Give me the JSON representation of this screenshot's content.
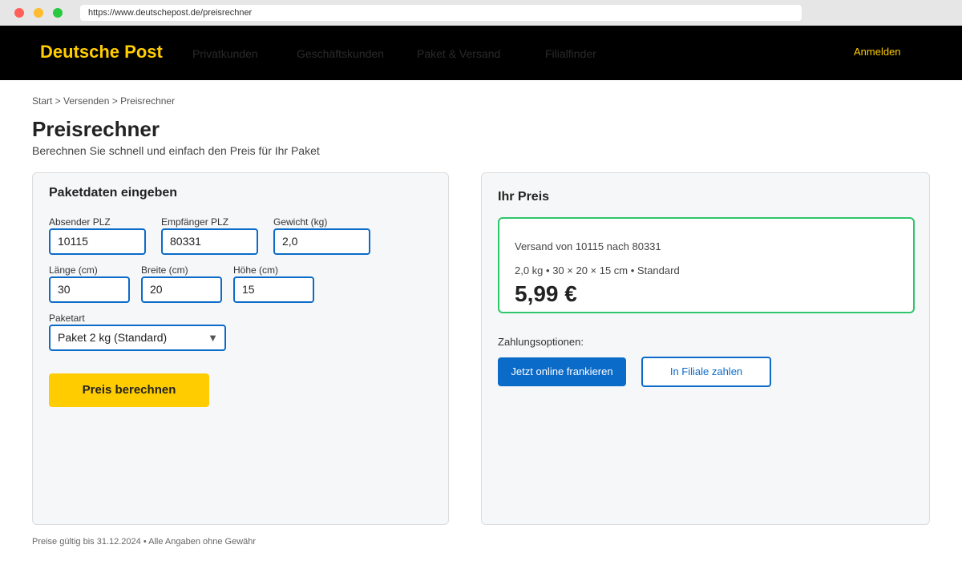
{
  "browser": {
    "url": "https://www.deutschepost.de/preisrechner"
  },
  "header": {
    "brand": "Deutsche Post",
    "nav": [
      "Privatkunden",
      "Geschäftskunden",
      "Paket & Versand",
      "Filialfinder"
    ],
    "login": "Anmelden"
  },
  "breadcrumb": "Start > Versenden > Preisrechner",
  "page": {
    "title": "Preisrechner",
    "subtitle": "Berechnen Sie schnell und einfach den Preis für Ihr Paket"
  },
  "form": {
    "title": "Paketdaten eingeben",
    "sender_zip_label": "Absender PLZ",
    "sender_zip_value": "10115",
    "recipient_zip_label": "Empfänger PLZ",
    "recipient_zip_value": "80331",
    "weight_label": "Gewicht (kg)",
    "weight_value": "2,0",
    "length_label": "Länge (cm)",
    "length_value": "30",
    "width_label": "Breite (cm)",
    "width_value": "20",
    "height_label": "Höhe (cm)",
    "height_value": "15",
    "type_label": "Paketart",
    "type_value": "Paket 2 kg (Standard)",
    "submit": "Preis berechnen"
  },
  "result": {
    "title": "Ihr Preis",
    "route": "Versand von 10115 nach 80331",
    "details": "2,0 kg • 30 × 20 × 15 cm • Standard",
    "price": "5,99 €",
    "payment_label": "Zahlungsoptionen:",
    "pay_online": "Jetzt online frankieren",
    "pay_branch": "In Filiale zahlen"
  },
  "footnote": "Preise gültig bis 31.12.2024 • Alle Angaben ohne Gewähr",
  "colors": {
    "brand_yellow": "#ffcc00",
    "header_bg": "#000000",
    "accent_blue": "#0b6bc9",
    "success_green": "#2ec66a"
  }
}
